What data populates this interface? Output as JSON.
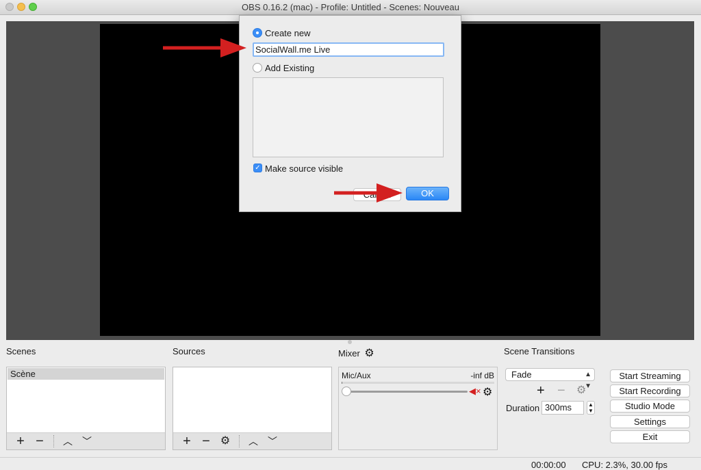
{
  "window": {
    "title": "OBS 0.16.2 (mac) - Profile: Untitled - Scenes: Nouveau"
  },
  "dialog": {
    "create_new_label": "Create new",
    "name_value": "SocialWall.me Live",
    "add_existing_label": "Add Existing",
    "make_visible_label": "Make source visible",
    "cancel_label": "Cancel",
    "ok_label": "OK"
  },
  "docks": {
    "scenes_title": "Scenes",
    "sources_title": "Sources",
    "mixer_title": "Mixer",
    "transitions_title": "Scene Transitions"
  },
  "scenes": {
    "items": [
      "Scène"
    ]
  },
  "mixer": {
    "channel": "Mic/Aux",
    "level": "-inf dB",
    "volume_fraction": 0.0
  },
  "transitions": {
    "selected": "Fade",
    "duration_label": "Duration",
    "duration_value": "300ms"
  },
  "controls": {
    "start_streaming": "Start Streaming",
    "start_recording": "Start Recording",
    "studio_mode": "Studio Mode",
    "settings": "Settings",
    "exit": "Exit"
  },
  "status": {
    "time": "00:00:00",
    "cpu": "CPU: 2.3%, 30.00 fps"
  },
  "colors": {
    "accent": "#3b8ef7",
    "annotation_arrow": "#d32020"
  },
  "icons": {
    "add": "+",
    "remove": "−",
    "up": "︿",
    "down": "﹀",
    "gear": "⚙",
    "mute": "🔇︎"
  }
}
